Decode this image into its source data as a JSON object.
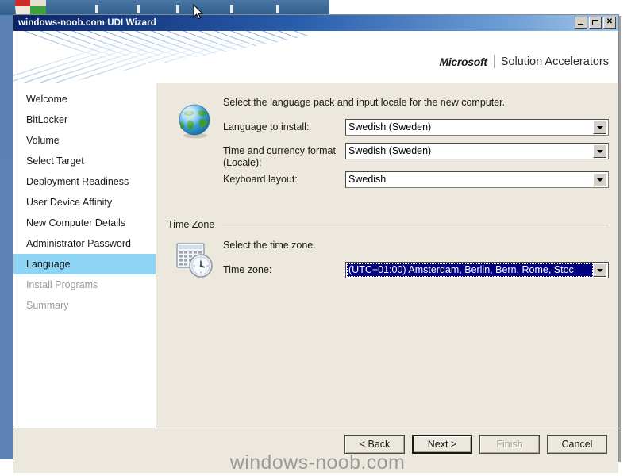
{
  "window": {
    "title": "windows-noob.com UDI Wizard",
    "buttons": {
      "minimize": "minimize-button",
      "maximize": "maximize-button",
      "close": "close-button"
    }
  },
  "branding": {
    "microsoft": "Microsoft",
    "product": "Solution Accelerators"
  },
  "sidebar": {
    "items": [
      {
        "label": "Welcome",
        "state": "normal"
      },
      {
        "label": "BitLocker",
        "state": "normal"
      },
      {
        "label": "Volume",
        "state": "normal"
      },
      {
        "label": "Select Target",
        "state": "normal"
      },
      {
        "label": "Deployment Readiness",
        "state": "normal"
      },
      {
        "label": "User Device Affinity",
        "state": "normal"
      },
      {
        "label": "New Computer Details",
        "state": "normal"
      },
      {
        "label": "Administrator Password",
        "state": "normal"
      },
      {
        "label": "Language",
        "state": "selected"
      },
      {
        "label": "Install Programs",
        "state": "disabled"
      },
      {
        "label": "Summary",
        "state": "disabled"
      }
    ]
  },
  "main": {
    "language_section": {
      "icon": "globe-icon",
      "intro": "Select the language pack and input locale for the new computer.",
      "fields": [
        {
          "label": "Language to install:",
          "value": "Swedish (Sweden)"
        },
        {
          "label": "Time and currency format (Locale):",
          "value": "Swedish (Sweden)"
        },
        {
          "label": "Keyboard layout:",
          "value": "Swedish"
        }
      ]
    },
    "timezone_section": {
      "group_title": "Time Zone",
      "icon": "calendar-clock-icon",
      "intro": "Select the time zone.",
      "field": {
        "label": "Time zone:",
        "value": "(UTC+01:00) Amsterdam, Berlin, Bern, Rome, Stoc"
      }
    }
  },
  "footer": {
    "back_label": "< Back",
    "next_label": "Next >",
    "finish_label": "Finish",
    "cancel_label": "Cancel"
  },
  "watermark": "windows-noob.com",
  "colors": {
    "selection_highlight": "#8ed4f5",
    "combo_selection": "#000080",
    "panel_background": "#ece8dd",
    "titlebar_start": "#0a246a"
  }
}
